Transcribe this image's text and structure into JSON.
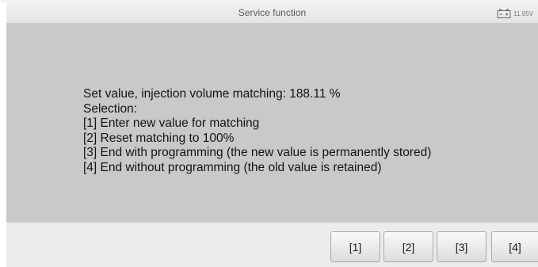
{
  "header": {
    "title": "Service function",
    "battery_voltage": "11.95V",
    "battery_icon": "battery-icon"
  },
  "message": {
    "lines": [
      "Set value, injection volume matching: 188.11 %",
      "Selection:",
      "[1] Enter new value for matching",
      "[2] Reset matching to 100%",
      "[3] End with programming (the new value is permanently stored)",
      "[4] End without programming (the old value is retained)"
    ]
  },
  "footer": {
    "buttons": [
      "[1]",
      "[2]",
      "[3]",
      "[4]"
    ]
  },
  "colors": {
    "content_background": "#c9c9c9",
    "header_background": "#e8e8e8",
    "footer_background": "#ececec"
  }
}
